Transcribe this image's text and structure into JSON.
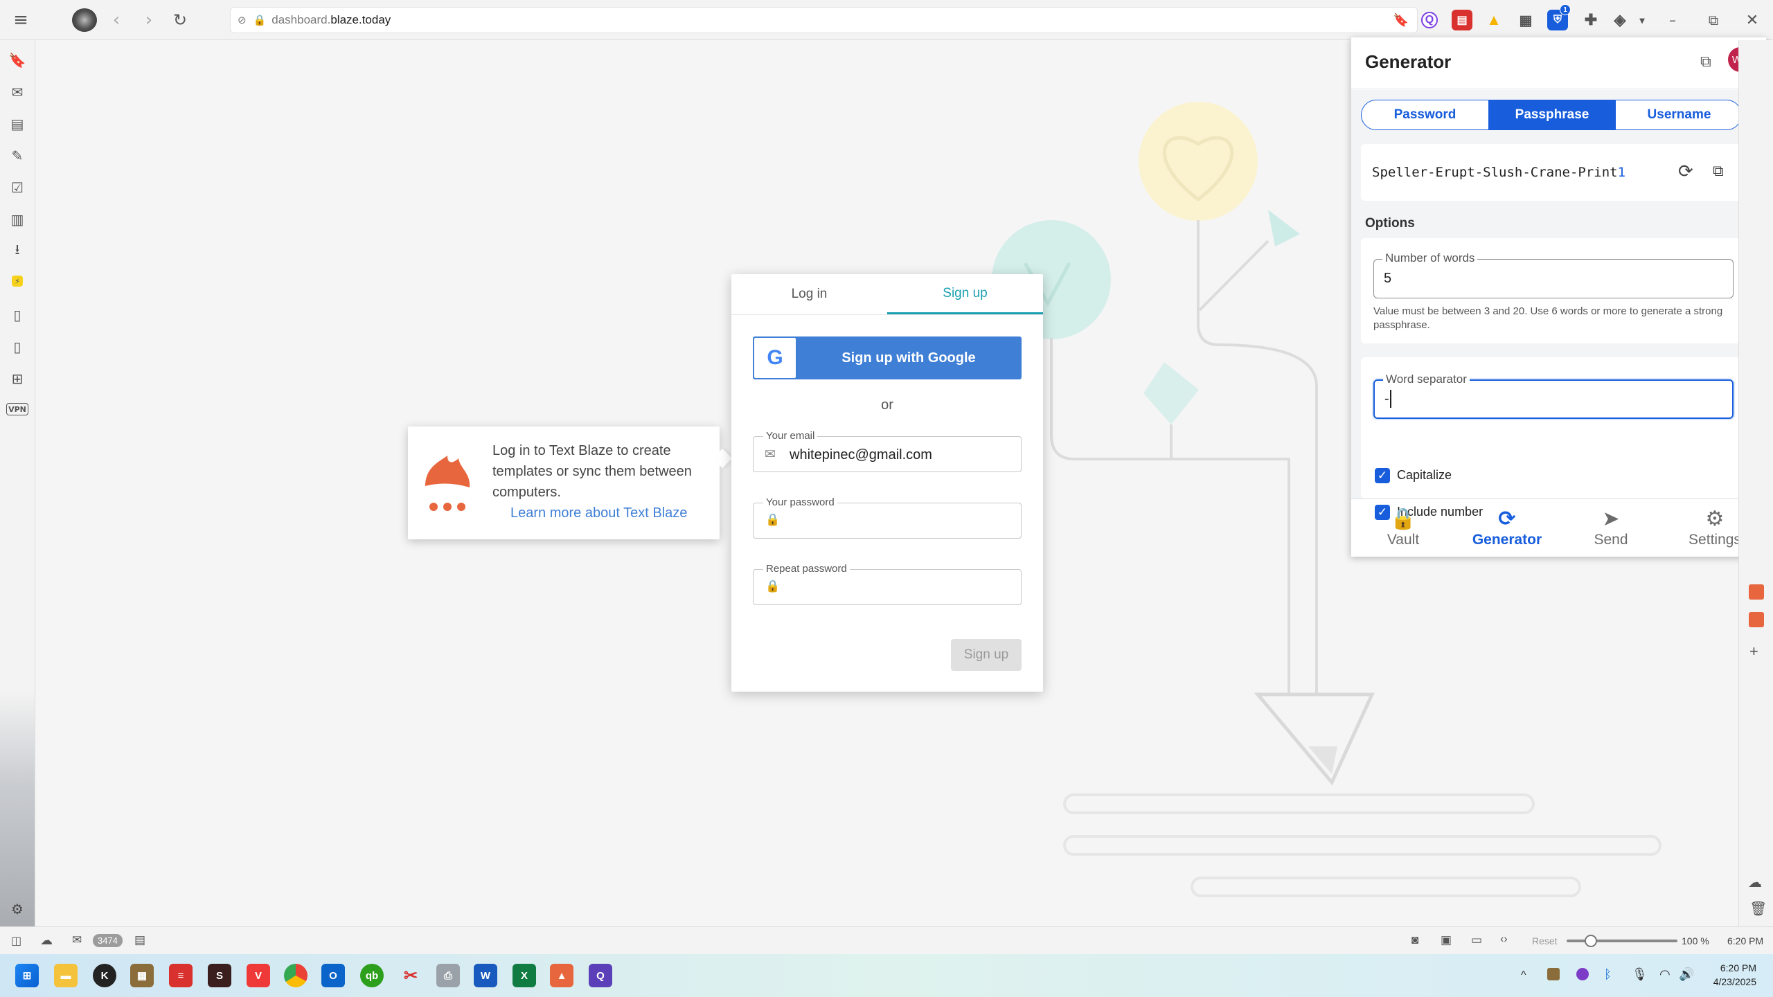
{
  "browser": {
    "url_host": "dashboard.",
    "url_domain": "blaze.today",
    "extension_badge": "1"
  },
  "status_bar": {
    "mail_count": "3474",
    "reset_label": "Reset",
    "zoom": "100 %",
    "zoom_level": 0.22,
    "time": "6:20 PM"
  },
  "login_card": {
    "tab_login": "Log in",
    "tab_signup": "Sign up",
    "google_button": "Sign up with Google",
    "or_text": "or",
    "email_label": "Your email",
    "email_value": "whitepinec@gmail.com",
    "password_label": "Your password",
    "repeat_label": "Repeat password",
    "submit_label": "Sign up"
  },
  "tooltip": {
    "text": "Log in to Text Blaze to create templates or sync them between computers.",
    "link": "Learn more about Text Blaze"
  },
  "bitwarden": {
    "title": "Generator",
    "avatar": "WP",
    "tabs": [
      "Password",
      "Passphrase",
      "Username"
    ],
    "active_tab": "Passphrase",
    "generated": "Speller-Erupt-Slush-Crane-Print",
    "generated_number": "1",
    "options_heading": "Options",
    "words_label": "Number of words",
    "words_value": "5",
    "words_hint": "Value must be between 3 and 20. Use 6 words or more to generate a strong passphrase.",
    "separator_label": "Word separator",
    "separator_value": "-",
    "capitalize_label": "Capitalize",
    "include_number_label": "Include number",
    "nav": [
      "Vault",
      "Generator",
      "Send",
      "Settings"
    ],
    "active_nav": "Generator"
  },
  "taskbar": {
    "time": "6:20 PM",
    "date": "4/23/2025"
  },
  "colors": {
    "teal_accent": "#1a9fb0",
    "google_blue": "#3f7fd6",
    "bitwarden_blue": "#175ddc",
    "blaze_orange": "#e8663d"
  }
}
